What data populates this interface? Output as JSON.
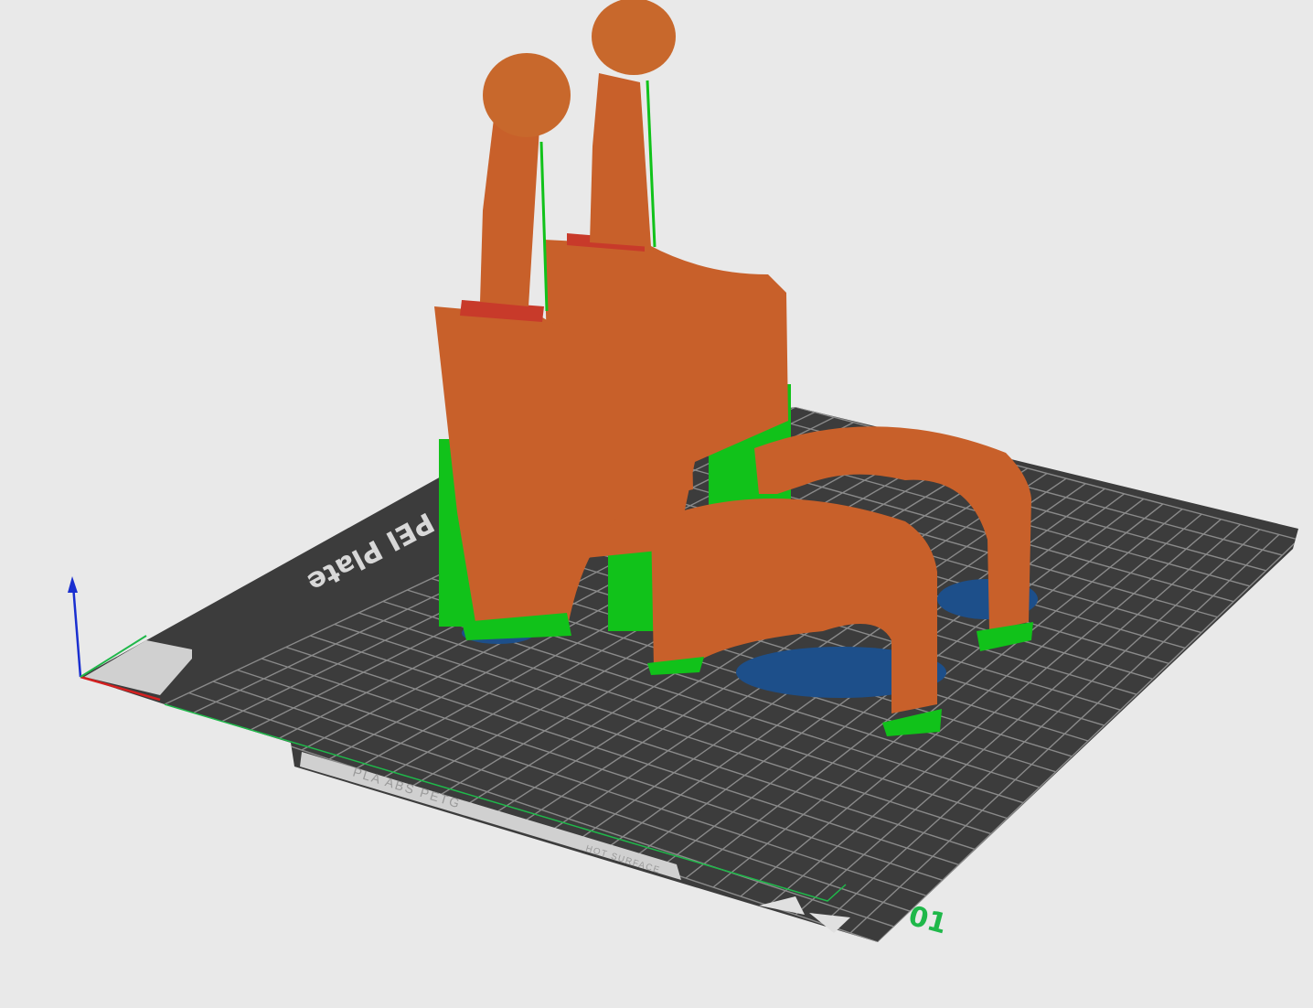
{
  "viewport": {
    "plate_number": "01",
    "bed_label": "PEI Plate",
    "bed_markings": [
      "PLA ABS PETG",
      "HOT SURFACE"
    ],
    "axes": {
      "x_color": "#d42020",
      "y_color": "#1fb84a",
      "z_color": "#1a2fd0"
    }
  },
  "colors": {
    "background": "#e9e9e9",
    "plate": "#3c3c3c",
    "grid": "#8a8a8a",
    "model": "#c8602a",
    "support": "#11c21a",
    "raft": "#1d4f8a",
    "overhang": "#c83a2a"
  }
}
